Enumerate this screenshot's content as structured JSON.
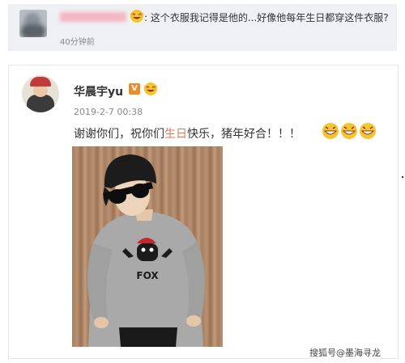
{
  "comment": {
    "text": ": 这个衣服我记得是他的...好像他每年生日都穿这件衣服?",
    "time": "40分钟前"
  },
  "post": {
    "author": "华晨宇yu",
    "verified_badge": "V",
    "date": "2019-2-7 00:38",
    "text_before": "谢谢你们，祝你们",
    "text_highlight": "生日",
    "text_after": "快乐，猪年好合！！！",
    "emoji_count": 3,
    "photo_text": "FOX"
  },
  "colors": {
    "highlight": "#eb7350",
    "badge": "#f08a24",
    "comment_bg": "#eef0f3"
  },
  "watermark": "搜狐号@墨海寻龙"
}
